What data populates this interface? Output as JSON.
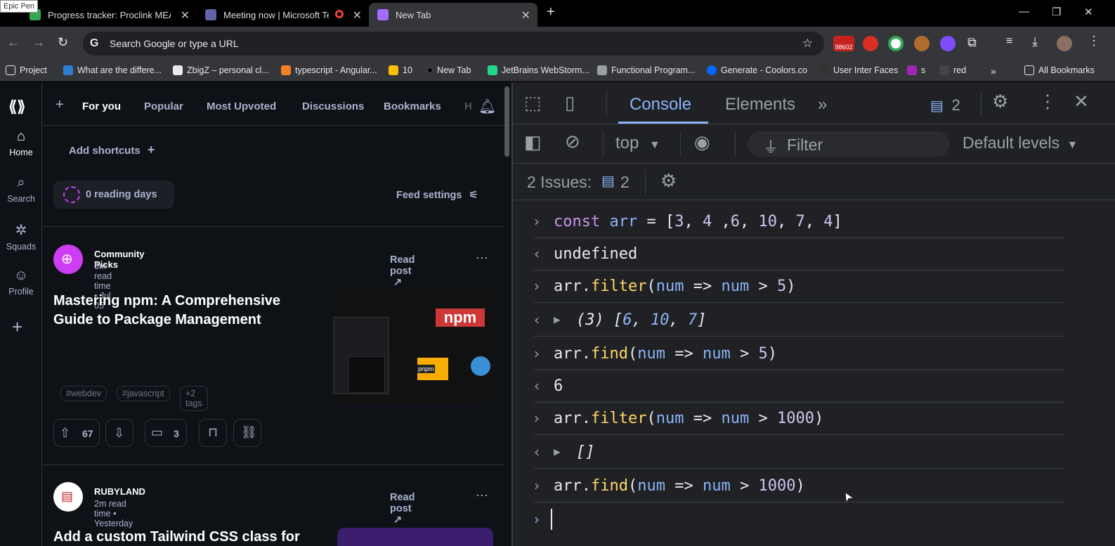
{
  "overlay": {
    "epic_pen": "Epic Pen"
  },
  "tabs": [
    {
      "title": "Progress tracker: Proclink MEAN",
      "color": "#34a853"
    },
    {
      "title": "Meeting now | Microsoft Teams",
      "color": "#6264a7"
    },
    {
      "title": "New Tab",
      "color": "#a66bff"
    }
  ],
  "toolbar": {
    "omnibox_placeholder": "Search Google or type a URL",
    "badge_count": "98602"
  },
  "bookmarks": [
    "Project",
    "What are the differe...",
    "ZbigZ – personal cl...",
    "typescript - Angular...",
    "10",
    "New Tab",
    "JetBrains WebStorm...",
    "Functional Program...",
    "Generate - Coolors.co",
    "User Inter Faces",
    "s",
    "red",
    "All Bookmarks"
  ],
  "daily": {
    "left_nav": [
      "Home",
      "Search",
      "Squads",
      "Profile"
    ],
    "top_nav": [
      "For you",
      "Popular",
      "Most Upvoted",
      "Discussions",
      "Bookmarks",
      "H"
    ],
    "add_shortcuts": "Add shortcuts",
    "reading_days": "0 reading days",
    "feed_settings": "Feed settings",
    "posts": [
      {
        "source": "Community Picks",
        "meta": "6m read time • Jul 05",
        "read_post": "Read post",
        "title_line1": "Mastering npm: A Comprehensive",
        "title_line2": "Guide to Package Management",
        "tags": [
          "#webdev",
          "#javascript",
          "+2 tags"
        ],
        "upvotes": "67",
        "comments": "3",
        "thumb_text_npm": "npm",
        "thumb_text_pnpm": "pnpm"
      },
      {
        "source": "RUBYLAND",
        "meta": "2m read time • Yesterday",
        "read_post": "Read post",
        "title_line1": "Add a custom Tailwind CSS class for"
      }
    ]
  },
  "devtools": {
    "tabs": {
      "console": "Console",
      "elements": "Elements"
    },
    "issues_badge": "2",
    "context": "top",
    "filter_placeholder": "Filter",
    "levels": "Default levels",
    "issues_label": "2 Issues:",
    "issues_count": "2",
    "console_lines": [
      {
        "kind": "input",
        "text": "const arr = [3, 4 ,6, 10, 7, 4]"
      },
      {
        "kind": "output",
        "text": "undefined"
      },
      {
        "kind": "input",
        "text": "arr.filter(num => num > 5)"
      },
      {
        "kind": "output",
        "text": "(3) [6, 10, 7]"
      },
      {
        "kind": "input",
        "text": "arr.find(num => num > 5)"
      },
      {
        "kind": "output",
        "text": "6"
      },
      {
        "kind": "input",
        "text": "arr.filter(num => num > 1000)"
      },
      {
        "kind": "output",
        "text": "[]"
      },
      {
        "kind": "input",
        "text": "arr.find(num => num > 1000)"
      }
    ]
  }
}
